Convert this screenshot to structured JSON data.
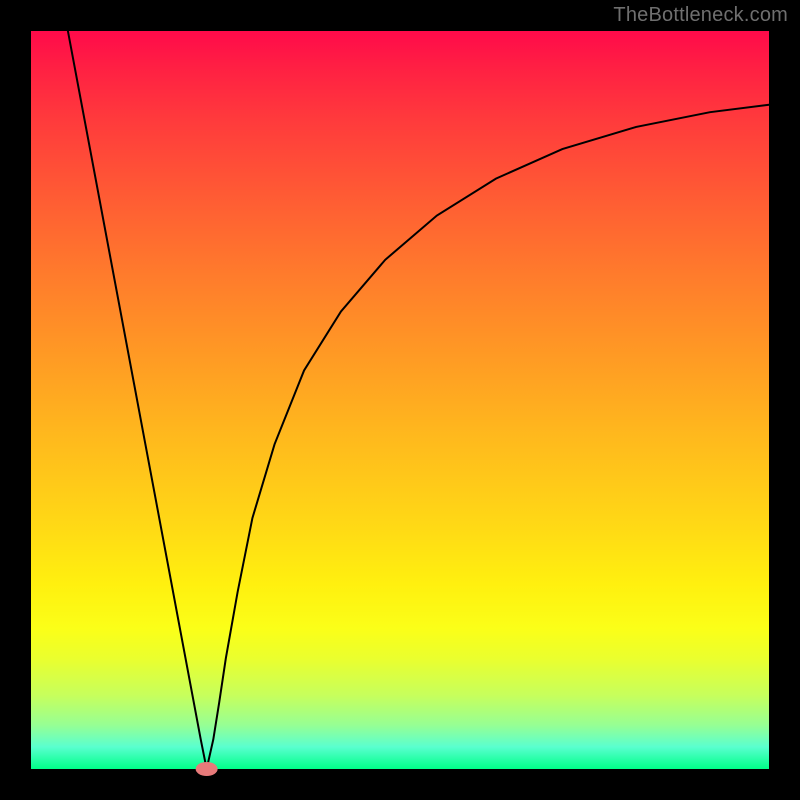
{
  "watermark": "TheBottleneck.com",
  "chart_data": {
    "type": "line",
    "title": "",
    "xlabel": "",
    "ylabel": "",
    "xlim": [
      0,
      100
    ],
    "ylim": [
      0,
      100
    ],
    "grid": false,
    "series": [
      {
        "name": "bottleneck-curve",
        "x": [
          5.0,
          6.5,
          8.0,
          9.5,
          11.0,
          12.5,
          14.0,
          15.5,
          17.0,
          18.5,
          20.0,
          21.5,
          23.0,
          23.8,
          24.7,
          25.5,
          26.4,
          28.0,
          30.0,
          33.0,
          37.0,
          42.0,
          48.0,
          55.0,
          63.0,
          72.0,
          82.0,
          92.0,
          100.0
        ],
        "values": [
          100.0,
          92.0,
          84.0,
          76.0,
          68.0,
          60.0,
          52.0,
          44.0,
          36.0,
          28.0,
          20.0,
          12.0,
          4.0,
          0.0,
          4.0,
          9.0,
          15.0,
          24.0,
          34.0,
          44.0,
          54.0,
          62.0,
          69.0,
          75.0,
          80.0,
          84.0,
          87.0,
          89.0,
          90.0
        ]
      }
    ],
    "markers": [
      {
        "name": "min-marker",
        "x": 23.8,
        "y": 0.0,
        "shape": "rounded",
        "color": "#e77a7a"
      }
    ],
    "background_gradient": {
      "top": "#ff0a4a",
      "mid": "#ffd616",
      "bottom": "#00ff88"
    }
  }
}
